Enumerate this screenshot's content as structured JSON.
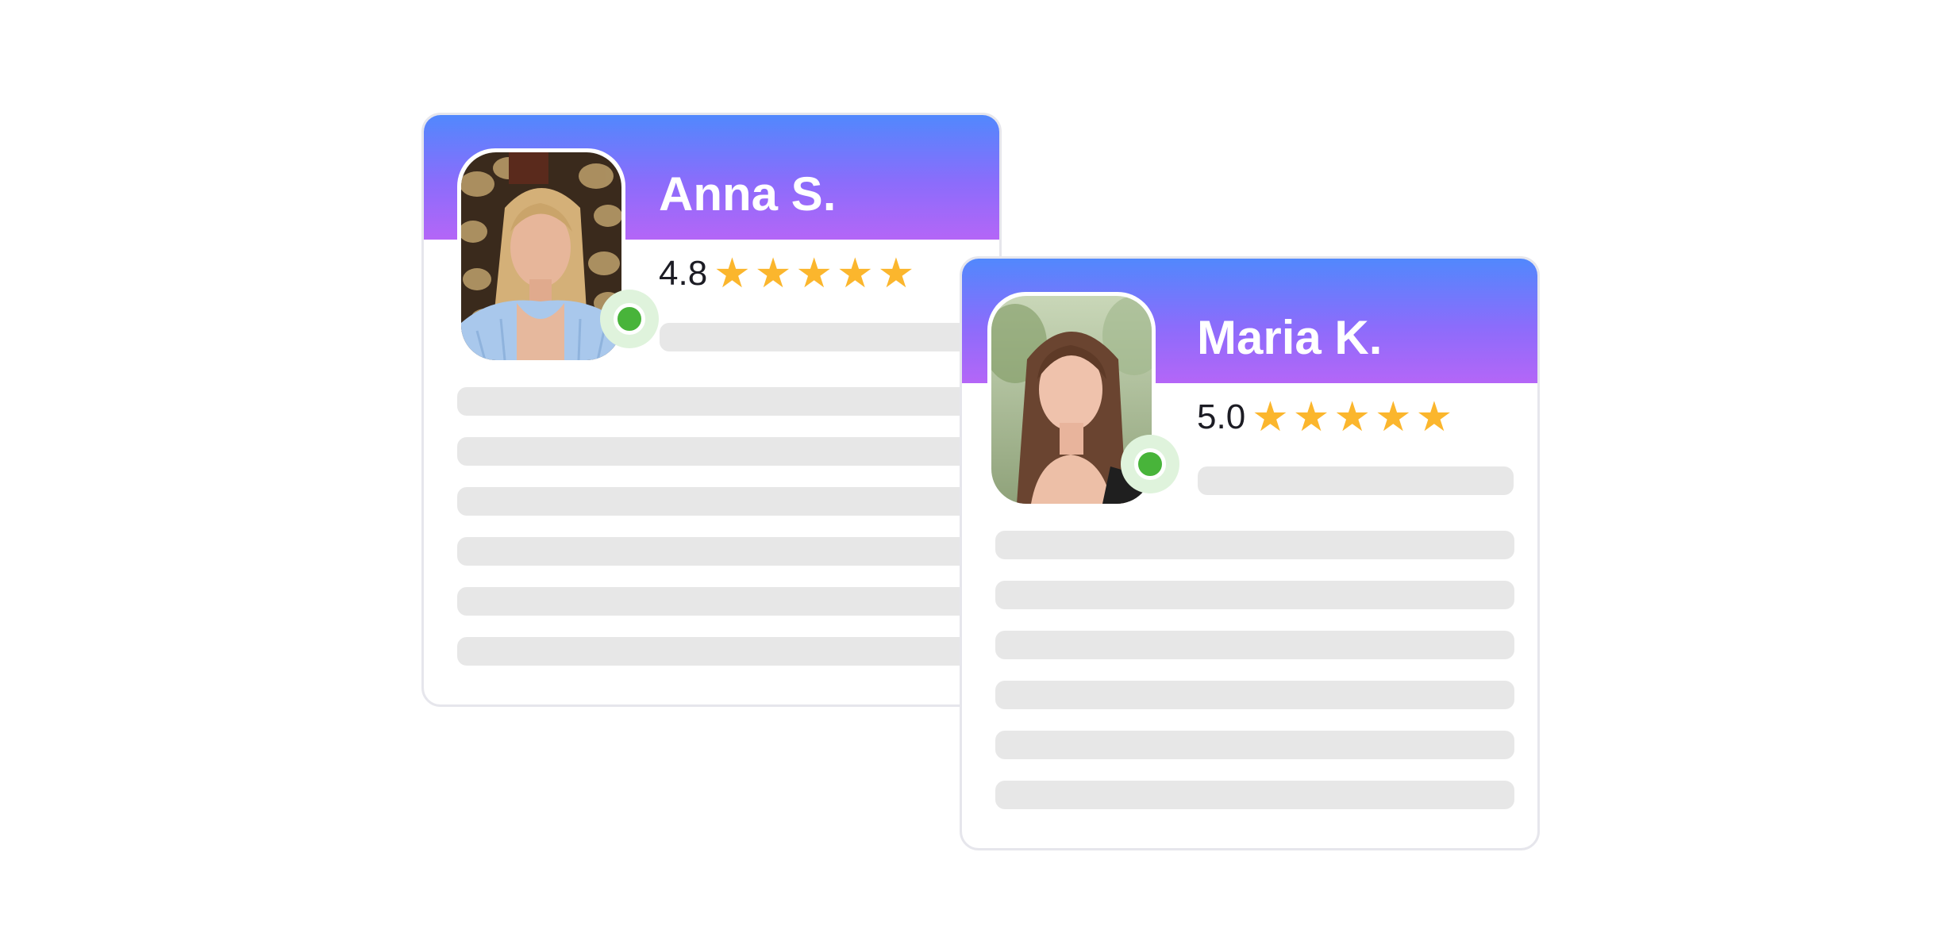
{
  "profiles": [
    {
      "name": "Anna S.",
      "rating": "4.8",
      "stars": [
        "★",
        "★",
        "★",
        "★",
        "★"
      ],
      "online": true
    },
    {
      "name": "Maria K.",
      "rating": "5.0",
      "stars": [
        "★",
        "★",
        "★",
        "★",
        "★"
      ],
      "online": true
    }
  ],
  "colors": {
    "header_gradient": [
      "#5188fd",
      "#b466f7"
    ],
    "star": "#fbb62d",
    "online": "#48b43a",
    "skeleton": "#e7e7e7"
  }
}
